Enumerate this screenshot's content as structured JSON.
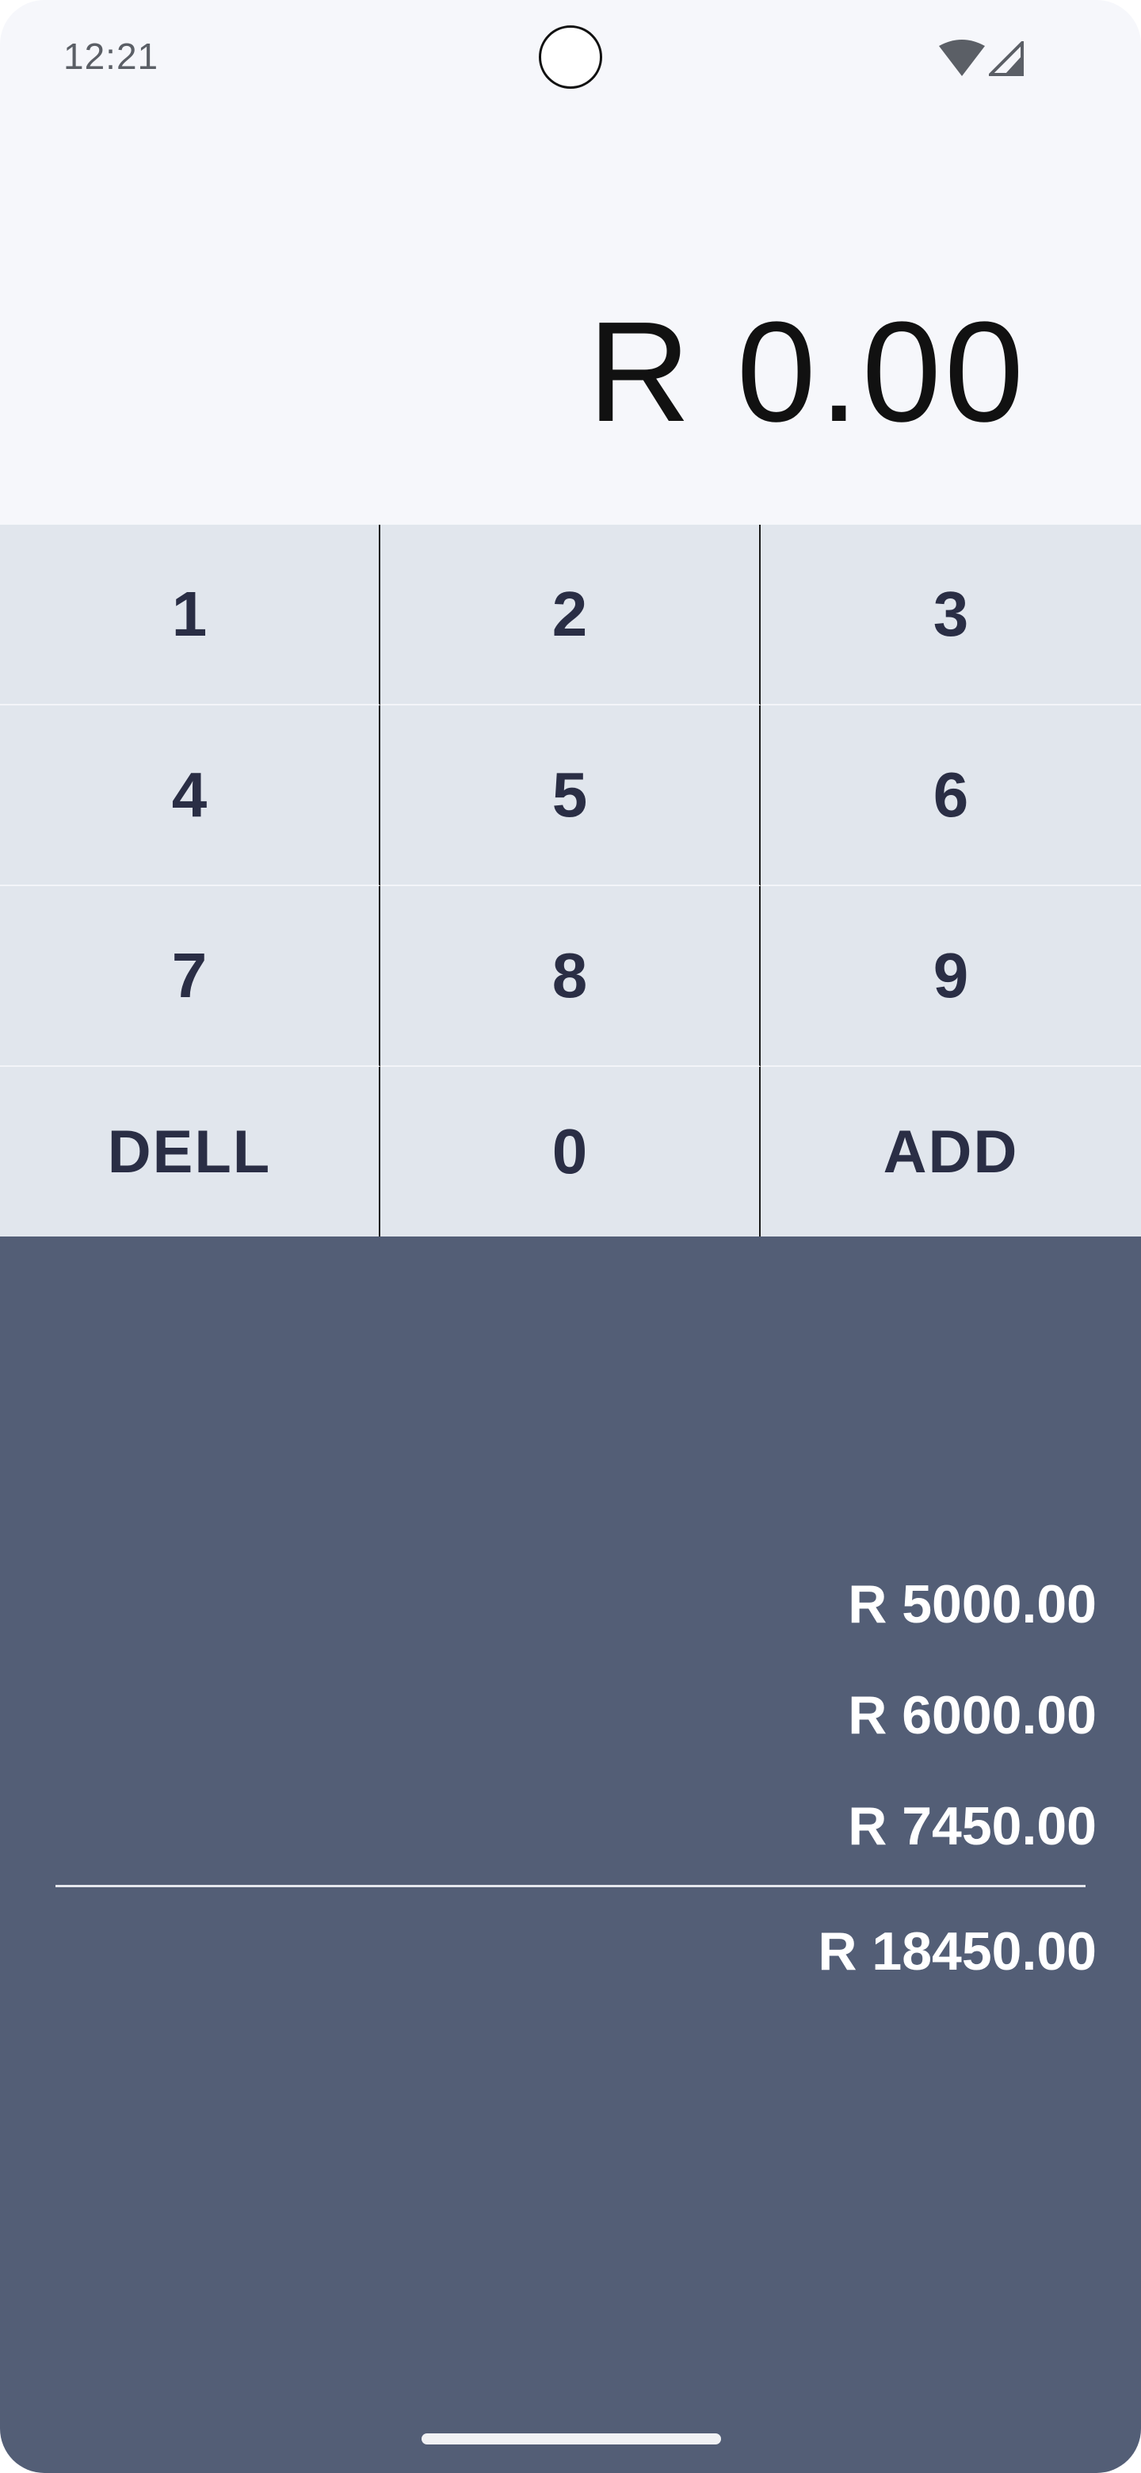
{
  "status_bar": {
    "time": "12:21",
    "icons": [
      "wifi-icon",
      "cellular-signal-icon"
    ]
  },
  "display": {
    "value": "R 0.00"
  },
  "keypad": {
    "keys": [
      {
        "label": "1"
      },
      {
        "label": "2"
      },
      {
        "label": "3"
      },
      {
        "label": "4"
      },
      {
        "label": "5"
      },
      {
        "label": "6"
      },
      {
        "label": "7"
      },
      {
        "label": "8"
      },
      {
        "label": "9"
      },
      {
        "label": "DELL"
      },
      {
        "label": "0"
      },
      {
        "label": "ADD"
      }
    ]
  },
  "results": {
    "entries": [
      "R 5000.00",
      "R 6000.00",
      "R 7450.00"
    ],
    "total": "R 18450.00"
  },
  "colors": {
    "display_bg": "#f6f7fb",
    "keypad_bg": "#e1e6ed",
    "key_text": "#2a2e45",
    "results_bg": "#535e76",
    "results_text": "#ffffff"
  }
}
